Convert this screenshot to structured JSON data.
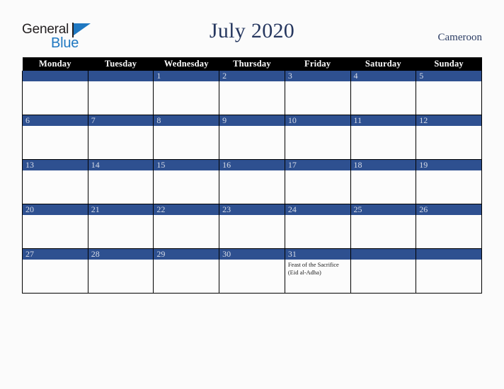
{
  "brand": {
    "name_part1": "General",
    "name_part2": "Blue",
    "primary_color": "#1f78c1",
    "text_color": "#231f20"
  },
  "header": {
    "title": "July 2020",
    "country": "Cameroon",
    "title_color": "#26375f"
  },
  "calendar": {
    "weekday_headers": [
      "Monday",
      "Tuesday",
      "Wednesday",
      "Thursday",
      "Friday",
      "Saturday",
      "Sunday"
    ],
    "header_bg": "#000000",
    "daynum_bg": "#2e5090",
    "daynum_color": "#d7dce8",
    "cell_bg": "#fcfcfc",
    "weeks": [
      [
        {
          "day": "",
          "holiday": ""
        },
        {
          "day": "",
          "holiday": ""
        },
        {
          "day": "1",
          "holiday": ""
        },
        {
          "day": "2",
          "holiday": ""
        },
        {
          "day": "3",
          "holiday": ""
        },
        {
          "day": "4",
          "holiday": ""
        },
        {
          "day": "5",
          "holiday": ""
        }
      ],
      [
        {
          "day": "6",
          "holiday": ""
        },
        {
          "day": "7",
          "holiday": ""
        },
        {
          "day": "8",
          "holiday": ""
        },
        {
          "day": "9",
          "holiday": ""
        },
        {
          "day": "10",
          "holiday": ""
        },
        {
          "day": "11",
          "holiday": ""
        },
        {
          "day": "12",
          "holiday": ""
        }
      ],
      [
        {
          "day": "13",
          "holiday": ""
        },
        {
          "day": "14",
          "holiday": ""
        },
        {
          "day": "15",
          "holiday": ""
        },
        {
          "day": "16",
          "holiday": ""
        },
        {
          "day": "17",
          "holiday": ""
        },
        {
          "day": "18",
          "holiday": ""
        },
        {
          "day": "19",
          "holiday": ""
        }
      ],
      [
        {
          "day": "20",
          "holiday": ""
        },
        {
          "day": "21",
          "holiday": ""
        },
        {
          "day": "22",
          "holiday": ""
        },
        {
          "day": "23",
          "holiday": ""
        },
        {
          "day": "24",
          "holiday": ""
        },
        {
          "day": "25",
          "holiday": ""
        },
        {
          "day": "26",
          "holiday": ""
        }
      ],
      [
        {
          "day": "27",
          "holiday": ""
        },
        {
          "day": "28",
          "holiday": ""
        },
        {
          "day": "29",
          "holiday": ""
        },
        {
          "day": "30",
          "holiday": ""
        },
        {
          "day": "31",
          "holiday": "Feast of the Sacrifice (Eid al-Adha)"
        },
        {
          "day": "",
          "holiday": ""
        },
        {
          "day": "",
          "holiday": ""
        }
      ]
    ]
  }
}
